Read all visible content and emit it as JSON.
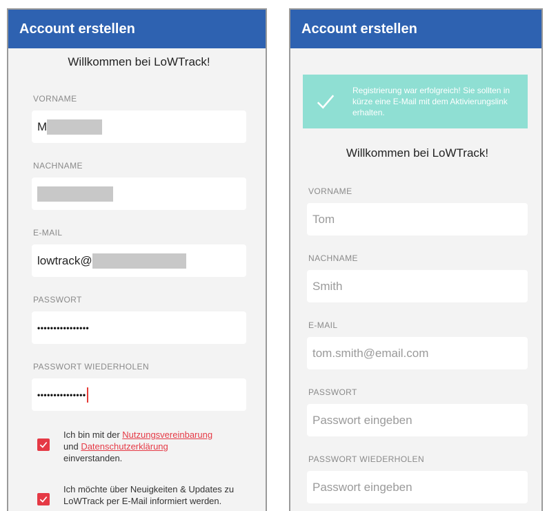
{
  "left": {
    "title": "Account erstellen",
    "welcome": "Willkommen bei LoWTrack!",
    "fields": {
      "first_name_label": "VORNAME",
      "first_name_value": "M",
      "last_name_label": "NACHNAME",
      "email_label": "E-MAIL",
      "email_value": "lowtrack@",
      "password_label": "PASSWORT",
      "password_value": "••••••••••••••••",
      "password_repeat_label": "PASSWORT WIEDERHOLEN",
      "password_repeat_value": "•••••••••••••••"
    },
    "terms": {
      "prefix": "Ich bin mit der ",
      "link1": "Nutzungsvereinbarung",
      "mid": " und ",
      "link2": "Datenschutzerklärung",
      "suffix": " einverstanden."
    },
    "newsletter": "Ich möchte über Neuigkeiten & Updates zu LoWTrack per E-Mail informiert werden."
  },
  "right": {
    "title": "Account erstellen",
    "success_message": "Registrierung war erfolgreich! Sie sollten in kürze eine E-Mail mit dem Aktivierungslink erhalten.",
    "welcome": "Willkommen bei LoWTrack!",
    "fields": {
      "first_name_label": "VORNAME",
      "first_name_placeholder": "Tom",
      "last_name_label": "NACHNAME",
      "last_name_placeholder": "Smith",
      "email_label": "E-MAIL",
      "email_placeholder": "tom.smith@email.com",
      "password_label": "PASSWORT",
      "password_placeholder": "Passwort eingeben",
      "password_repeat_label": "PASSWORT WIEDERHOLEN",
      "password_repeat_placeholder": "Passwort eingeben"
    }
  },
  "colors": {
    "appbar": "#2e62b1",
    "accent_red": "#e53945",
    "success_banner": "#8fdfd3",
    "icons": [
      "checkbox-check-icon",
      "success-check-icon"
    ]
  }
}
